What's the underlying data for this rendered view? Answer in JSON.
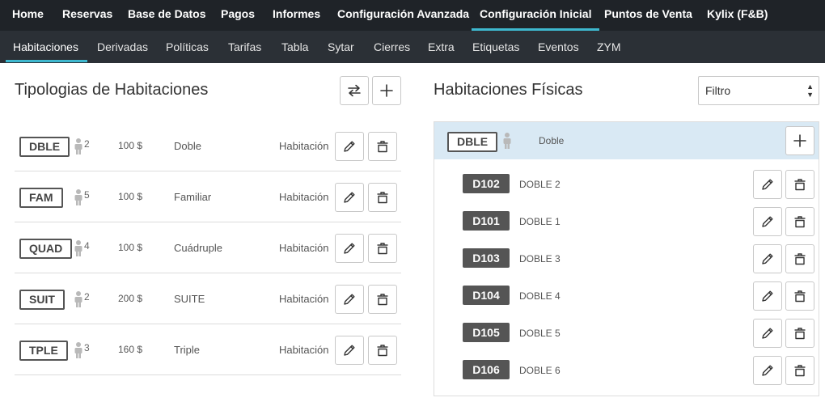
{
  "topnav": {
    "items": [
      {
        "label": "Home"
      },
      {
        "label": "Reservas"
      },
      {
        "label": "Base de Datos"
      },
      {
        "label": "Pagos"
      },
      {
        "label": "Informes"
      },
      {
        "label": "Configuración Avanzada"
      },
      {
        "label": "Configuración Inicial"
      },
      {
        "label": "Puntos de Venta"
      },
      {
        "label": "Kylix (F&B)"
      }
    ],
    "active": "Configuración Inicial"
  },
  "subnav": {
    "items": [
      {
        "label": "Habitaciones"
      },
      {
        "label": "Derivadas"
      },
      {
        "label": "Políticas"
      },
      {
        "label": "Tarifas"
      },
      {
        "label": "Tabla"
      },
      {
        "label": "Sytar"
      },
      {
        "label": "Cierres"
      },
      {
        "label": "Extra"
      },
      {
        "label": "Etiquetas"
      },
      {
        "label": "Eventos"
      },
      {
        "label": "ZYM"
      }
    ],
    "active": "Habitaciones"
  },
  "left": {
    "title": "Tipologias de Habitaciones",
    "rows": [
      {
        "code": "DBLE",
        "capacity": "2",
        "price": "100 $",
        "description": "Doble",
        "kind": "Habitación"
      },
      {
        "code": "FAM",
        "capacity": "5",
        "price": "100 $",
        "description": "Familiar",
        "kind": "Habitación"
      },
      {
        "code": "QUAD",
        "capacity": "4",
        "price": "100 $",
        "description": "Cuádruple",
        "kind": "Habitación"
      },
      {
        "code": "SUIT",
        "capacity": "2",
        "price": "200 $",
        "description": "SUITE",
        "kind": "Habitación"
      },
      {
        "code": "TPLE",
        "capacity": "3",
        "price": "160 $",
        "description": "Triple",
        "kind": "Habitación"
      }
    ]
  },
  "right": {
    "title": "Habitaciones Físicas",
    "filter": {
      "selected": "Filtro"
    },
    "selected_type": {
      "code": "DBLE",
      "description": "Doble"
    },
    "rooms": [
      {
        "number": "D102",
        "name": "DOBLE 2"
      },
      {
        "number": "D101",
        "name": "DOBLE 1"
      },
      {
        "number": "D103",
        "name": "DOBLE 3"
      },
      {
        "number": "D104",
        "name": "DOBLE 4"
      },
      {
        "number": "D105",
        "name": "DOBLE 5"
      },
      {
        "number": "D106",
        "name": "DOBLE 6"
      }
    ]
  },
  "icons": {
    "swap": "swap-arrows-icon",
    "add": "plus-icon",
    "edit": "pencil-icon",
    "delete": "trash-icon",
    "person": "person-icon"
  },
  "colors": {
    "topnav_bg": "#1f2328",
    "subnav_bg": "#2b3036",
    "accent": "#3eb8cf",
    "selected_row_bg": "#d9e9f4",
    "badge_bg": "#555555"
  }
}
